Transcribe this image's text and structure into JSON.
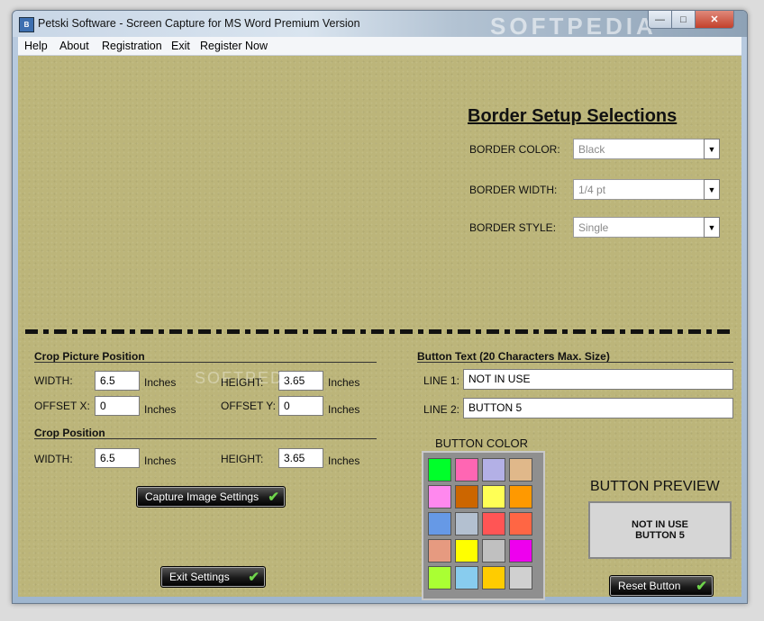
{
  "window": {
    "title": "Petski Software -  Screen Capture for MS Word Premium Version",
    "icon_text": "B",
    "watermark": "SOFTPEDIA"
  },
  "titlebar_buttons": {
    "minimize": "—",
    "maximize": "□",
    "close": "✕"
  },
  "menu": [
    "Help",
    "About",
    "Registration",
    "Exit",
    "Register Now"
  ],
  "border_setup": {
    "heading": "Border Setup Selections",
    "color_label": "BORDER COLOR:",
    "color_value": "Black",
    "width_label": "BORDER WIDTH:",
    "width_value": "1/4 pt",
    "style_label": "BORDER STYLE:",
    "style_value": "Single",
    "dropdown_arrow": "▼"
  },
  "crop_picture": {
    "heading": "Crop Picture Position",
    "width_label": "WIDTH:",
    "width_value": "6.5",
    "height_label": "HEIGHT:",
    "height_value": "3.65",
    "offsetx_label": "OFFSET X:",
    "offsetx_value": "0",
    "offsety_label": "OFFSET Y:",
    "offsety_value": "0",
    "unit": "Inches"
  },
  "crop_position": {
    "heading": "Crop  Position",
    "width_label": "WIDTH:",
    "width_value": "6.5",
    "height_label": "HEIGHT:",
    "height_value": "3.65",
    "unit": "Inches"
  },
  "button_text": {
    "heading": "Button Text (20 Characters Max. Size)",
    "line1_label": "LINE 1:",
    "line1_value": "NOT IN USE",
    "line2_label": "LINE 2:",
    "line2_value": "BUTTON 5"
  },
  "button_color": {
    "heading": "BUTTON COLOR",
    "swatches": [
      "#00ff2a",
      "#ff66b3",
      "#b3b0e6",
      "#e0b88a",
      "#ff88ee",
      "#cc6600",
      "#ffff55",
      "#ff9900",
      "#6699e6",
      "#b3c0d0",
      "#ff5555",
      "#ff6644",
      "#e69a80",
      "#ffff00",
      "#c0c0c0",
      "#ee00ee",
      "#aaff33",
      "#88ccee",
      "#ffcc00",
      "#d0d0d0"
    ]
  },
  "preview": {
    "heading": "BUTTON PREVIEW",
    "line1": "NOT IN USE",
    "line2": "BUTTON 5"
  },
  "buttons": {
    "capture": "Capture Image Settings",
    "exit": "Exit Settings",
    "reset": "Reset Button",
    "check": "✔"
  },
  "watermark_center": "SOFTPEDIA"
}
